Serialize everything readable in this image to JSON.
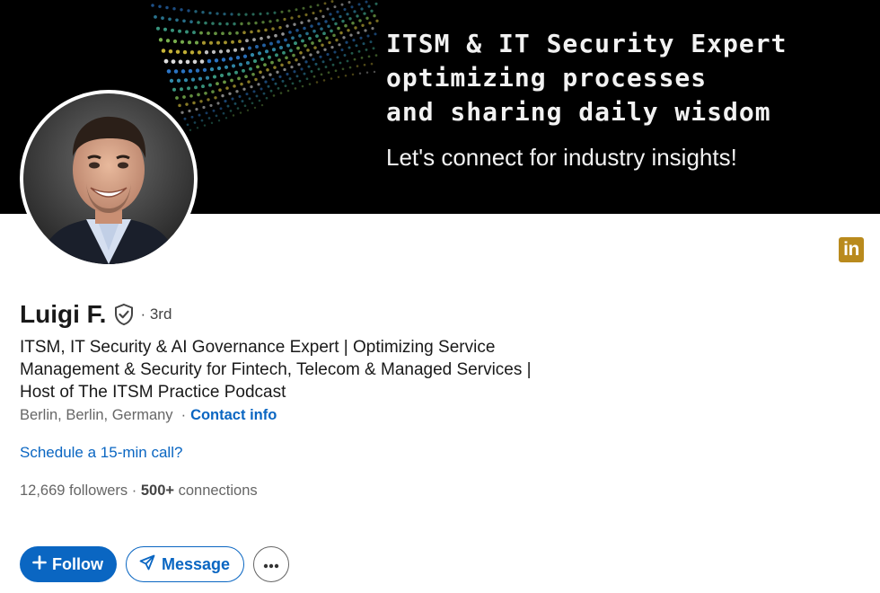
{
  "banner": {
    "headline_lines": [
      "ITSM & IT Security Expert",
      "optimizing processes",
      "and sharing daily wisdom"
    ],
    "tagline": "Let's connect for industry insights!"
  },
  "profile": {
    "name": "Luigi F.",
    "verified_icon": "shield-check-icon",
    "degree": "· 3rd",
    "headline": "ITSM, IT Security & AI Governance Expert | Optimizing Service Management & Security for Fintech, Telecom & Managed Services | Host of The ITSM Practice Podcast",
    "location": "Berlin, Berlin, Germany",
    "separator": "·",
    "contact_info_label": "Contact info",
    "schedule_link": "Schedule a 15-min call?",
    "followers": "12,669 followers",
    "stats_separator": " · ",
    "connections_count": "500+",
    "connections_label": " connections",
    "brand_badge": "in"
  },
  "actions": {
    "follow_label": "Follow",
    "message_label": "Message",
    "more_icon": "ellipsis-icon"
  },
  "colors": {
    "accent": "#0a66c2",
    "brand_badge": "#b98a1d",
    "banner_bg": "#000000",
    "secondary_text": "#666666"
  }
}
